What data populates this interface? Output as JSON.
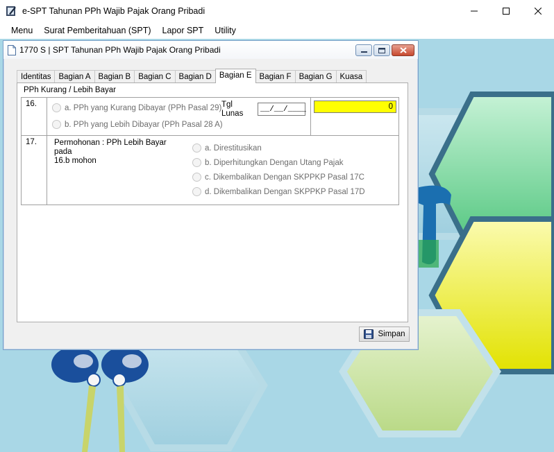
{
  "app": {
    "title": "e-SPT Tahunan PPh Wajib Pajak Orang Pribadi",
    "icons": [
      "app-icon",
      "minimize-icon",
      "maximize-icon",
      "close-icon"
    ]
  },
  "menu": {
    "items": [
      "Menu",
      "Surat Pemberitahuan (SPT)",
      "Lapor SPT",
      "Utility"
    ]
  },
  "child": {
    "title": "1770 S | SPT Tahunan PPh Wajib Pajak Orang Pribadi",
    "tabs": [
      "Identitas",
      "Bagian A",
      "Bagian B",
      "Bagian C",
      "Bagian D",
      "Bagian E",
      "Bagian F",
      "Bagian G",
      "Kuasa"
    ],
    "active_tab": "Bagian E",
    "section_title": "PPh Kurang / Lebih Bayar",
    "row16": {
      "number": "16.",
      "option_a": "a. PPh yang Kurang Dibayar (PPh Pasal 29)",
      "option_b": "b. PPh yang Lebih Dibayar (PPh Pasal 28 A)",
      "tgl_label_1": "Tgl",
      "tgl_label_2": "Lunas",
      "date_value": "__/__/____",
      "amount": "0"
    },
    "row17": {
      "number": "17.",
      "label_1": "Permohonan : PPh Lebih Bayar pada",
      "label_2": "16.b mohon",
      "options": [
        "a. Direstitusikan",
        "b. Diperhitungkan Dengan Utang Pajak",
        "c. Dikembalikan Dengan SKPPKP Pasal 17C",
        "d. Dikembalikan Dengan SKPPKP Pasal 17D"
      ]
    },
    "save_label": "Simpan"
  },
  "colors": {
    "amount_bg": "#ffff00",
    "workspace_bg": "#a9d7e6",
    "hex_green": "#5fd08a",
    "hex_yellow": "#f2f21a"
  }
}
